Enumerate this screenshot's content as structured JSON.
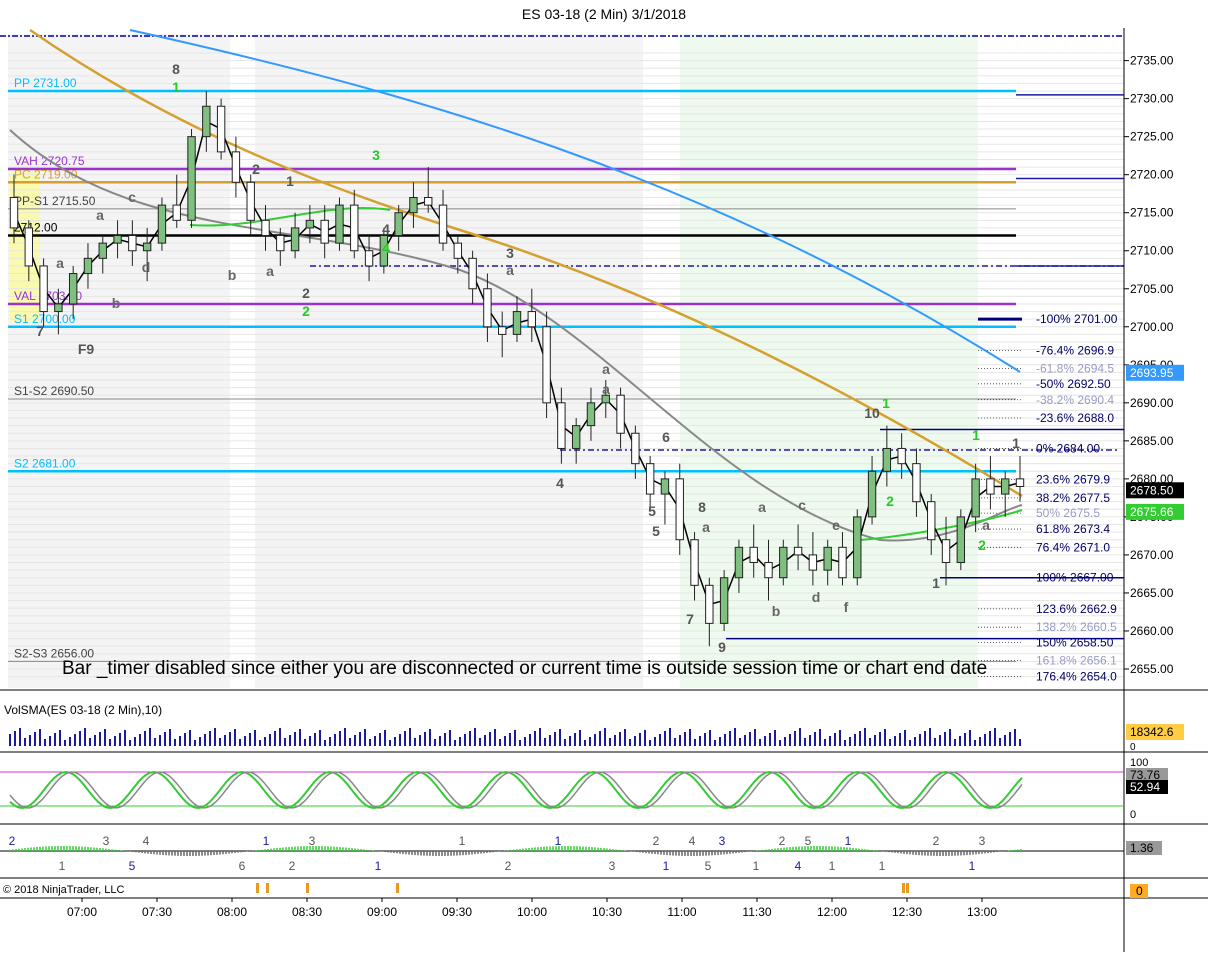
{
  "window": {
    "title": "ES 03-18 (2 Min)  3/1/2018"
  },
  "footer": {
    "copyright": "© 2018 NinjaTrader, LLC"
  },
  "colors": {
    "up": "#7fbf7f",
    "down": "#1a1a1a",
    "pivot": "#00bfff",
    "vah": "#9933cc",
    "pc": "#e6a23c",
    "sma_gray": "#888888",
    "sma_blue": "#3399ff",
    "sma_gold": "#d4a030",
    "fib": "#000080",
    "green": "#33cc33",
    "dash": "#0000aa"
  },
  "notice": {
    "text": "Bar _timer disabled since either you are disconnected or current time is outside session time or chart end date"
  },
  "chart_data": {
    "type": "candlestick",
    "title": "ES 03-18 (2 Min)  3/1/2018",
    "x_ticks": [
      "07:00",
      "07:30",
      "08:00",
      "08:30",
      "09:00",
      "09:30",
      "10:00",
      "10:30",
      "11:00",
      "11:30",
      "12:00",
      "12:30",
      "13:00"
    ],
    "y_ticks": [
      "2735.00",
      "2730.00",
      "2725.00",
      "2720.00",
      "2715.00",
      "2710.00",
      "2705.00",
      "2700.00",
      "2695.00",
      "2690.00",
      "2685.00",
      "2680.00",
      "2675.00",
      "2670.00",
      "2665.00",
      "2660.00",
      "2655.00"
    ],
    "ylim": [
      2652.5,
      2738.5
    ],
    "price_badges": [
      {
        "label": "2693.95",
        "value": 2693.95,
        "color": "#3399ff"
      },
      {
        "label": "2678.50",
        "value": 2678.5,
        "color": "#000000"
      },
      {
        "label": "2675.66",
        "value": 2675.66,
        "color": "#33cc33"
      }
    ],
    "levels": [
      {
        "label": "PP 2731.00",
        "value": 2731.0,
        "color": "#00bfff"
      },
      {
        "label": "VAH 2720.75",
        "value": 2720.75,
        "color": "#9933cc"
      },
      {
        "label": "PC 2719.00",
        "value": 2719.0,
        "color": "#d4a030"
      },
      {
        "label": "PP-S1 2715.50",
        "value": 2715.5,
        "color": "#888888"
      },
      {
        "label": "2712.00",
        "value": 2712.0,
        "color": "#000000"
      },
      {
        "label": "VAL 2703.00",
        "value": 2703.0,
        "color": "#9933cc"
      },
      {
        "label": "S1 2700.00",
        "value": 2700.0,
        "color": "#00bfff"
      },
      {
        "label": "S1-S2 2690.50",
        "value": 2690.5,
        "color": "#888888"
      },
      {
        "label": "S2 2681.00",
        "value": 2681.0,
        "color": "#00bfff"
      },
      {
        "label": "S2-S3 2656.00",
        "value": 2656.0,
        "color": "#888888"
      }
    ],
    "fib_levels": [
      {
        "label": "-100%  2701.00",
        "value": 2701.0
      },
      {
        "label": "-76.4%  2696.9",
        "value": 2696.9
      },
      {
        "label": "-61.8%  2694.5",
        "value": 2694.5
      },
      {
        "label": "-50%  2692.50",
        "value": 2692.5
      },
      {
        "label": "-38.2%  2690.4",
        "value": 2690.4
      },
      {
        "label": "-23.6%  2688.0",
        "value": 2688.0
      },
      {
        "label": "0%  2684.00",
        "value": 2684.0
      },
      {
        "label": "23.6%  2679.9",
        "value": 2679.9
      },
      {
        "label": "38.2%  2677.5",
        "value": 2677.5
      },
      {
        "label": "50%  2675.5",
        "value": 2675.5
      },
      {
        "label": "61.8%  2673.4",
        "value": 2673.4
      },
      {
        "label": "76.4%  2671.0",
        "value": 2671.0
      },
      {
        "label": "100%  2667.00",
        "value": 2667.0
      },
      {
        "label": "123.6%  2662.9",
        "value": 2662.9
      },
      {
        "label": "138.2%  2660.5",
        "value": 2660.5
      },
      {
        "label": "150%  2658.50",
        "value": 2658.5
      },
      {
        "label": "161.8%  2656.1",
        "value": 2656.1
      },
      {
        "label": "176.4%  2654.0",
        "value": 2654.0
      }
    ],
    "candles": [
      [
        2717,
        2720,
        2711,
        2713
      ],
      [
        2713,
        2714,
        2706,
        2708
      ],
      [
        2708,
        2709,
        2700,
        2702
      ],
      [
        2702,
        2705,
        2699,
        2703
      ],
      [
        2703,
        2708,
        2701,
        2707
      ],
      [
        2707,
        2711,
        2705,
        2709
      ],
      [
        2709,
        2712,
        2707,
        2711
      ],
      [
        2711,
        2714,
        2709,
        2712
      ],
      [
        2712,
        2714,
        2708,
        2710
      ],
      [
        2710,
        2713,
        2706,
        2711
      ],
      [
        2711,
        2717,
        2710,
        2716
      ],
      [
        2716,
        2720,
        2713,
        2714
      ],
      [
        2714,
        2726,
        2713,
        2725
      ],
      [
        2725,
        2731,
        2723,
        2729
      ],
      [
        2729,
        2730,
        2722,
        2723
      ],
      [
        2723,
        2725,
        2717,
        2719
      ],
      [
        2719,
        2720,
        2712,
        2714
      ],
      [
        2714,
        2716,
        2710,
        2712
      ],
      [
        2712,
        2713,
        2708,
        2710
      ],
      [
        2710,
        2715,
        2709,
        2713
      ],
      [
        2713,
        2716,
        2711,
        2714
      ],
      [
        2714,
        2716,
        2709,
        2711
      ],
      [
        2711,
        2717,
        2710,
        2716
      ],
      [
        2716,
        2718,
        2709,
        2710
      ],
      [
        2710,
        2712,
        2706,
        2708
      ],
      [
        2708,
        2713,
        2707,
        2712
      ],
      [
        2712,
        2716,
        2710,
        2715
      ],
      [
        2715,
        2719,
        2713,
        2717
      ],
      [
        2717,
        2721,
        2715,
        2716
      ],
      [
        2716,
        2718,
        2710,
        2711
      ],
      [
        2711,
        2712,
        2707,
        2709
      ],
      [
        2709,
        2710,
        2703,
        2705
      ],
      [
        2705,
        2707,
        2698,
        2700
      ],
      [
        2700,
        2702,
        2696,
        2699
      ],
      [
        2699,
        2704,
        2698,
        2702
      ],
      [
        2702,
        2705,
        2698,
        2700
      ],
      [
        2700,
        2702,
        2688,
        2690
      ],
      [
        2690,
        2692,
        2682,
        2684
      ],
      [
        2684,
        2688,
        2682,
        2687
      ],
      [
        2687,
        2692,
        2685,
        2690
      ],
      [
        2690,
        2693,
        2688,
        2691
      ],
      [
        2691,
        2692,
        2684,
        2686
      ],
      [
        2686,
        2687,
        2680,
        2682
      ],
      [
        2682,
        2683,
        2676,
        2678
      ],
      [
        2678,
        2681,
        2674,
        2680
      ],
      [
        2680,
        2682,
        2670,
        2672
      ],
      [
        2672,
        2673,
        2664,
        2666
      ],
      [
        2666,
        2667,
        2658,
        2661
      ],
      [
        2661,
        2668,
        2660,
        2667
      ],
      [
        2667,
        2672,
        2665,
        2671
      ],
      [
        2671,
        2674,
        2667,
        2669
      ],
      [
        2669,
        2672,
        2664,
        2667
      ],
      [
        2667,
        2672,
        2666,
        2671
      ],
      [
        2671,
        2674,
        2668,
        2670
      ],
      [
        2670,
        2673,
        2666,
        2668
      ],
      [
        2668,
        2672,
        2666,
        2671
      ],
      [
        2671,
        2673,
        2666,
        2667
      ],
      [
        2667,
        2676,
        2666,
        2675
      ],
      [
        2675,
        2683,
        2674,
        2681
      ],
      [
        2681,
        2687,
        2679,
        2684
      ],
      [
        2684,
        2686,
        2680,
        2682
      ],
      [
        2682,
        2684,
        2675,
        2677
      ],
      [
        2677,
        2678,
        2670,
        2672
      ],
      [
        2672,
        2675,
        2666,
        2669
      ],
      [
        2669,
        2676,
        2668,
        2675
      ],
      [
        2675,
        2682,
        2673,
        2680
      ],
      [
        2680,
        2683,
        2676,
        2678
      ],
      [
        2678,
        2681,
        2675,
        2680
      ],
      [
        2680,
        2683,
        2677,
        2679
      ]
    ],
    "annotations_text": [
      "8",
      "1",
      "2",
      "3",
      "1",
      "4",
      "a",
      "a",
      "2",
      "2",
      "a",
      "3",
      "4",
      "a",
      "6",
      "5",
      "7",
      "8",
      "a",
      "9",
      "a",
      "b",
      "c",
      "d",
      "e",
      "f",
      "10",
      "1",
      "2",
      "1",
      "1",
      "a",
      "2",
      "b",
      "F9",
      "7",
      "a",
      "b",
      "c",
      "d",
      "a",
      "1",
      "4",
      "5"
    ],
    "panels": {
      "volume": {
        "label": "VolSMA(ES 03-18 (2 Min),10)",
        "badges": [
          "18342.6",
          "0"
        ]
      },
      "stochastic": {
        "badges": [
          "73.76",
          "52.94"
        ],
        "ticks": [
          "100",
          "0"
        ]
      },
      "momentum": {
        "badges": [
          "1.36"
        ],
        "labels": [
          "2",
          "1",
          "3",
          "5",
          "4",
          "6",
          "1",
          "2",
          "3",
          "1",
          "1",
          "2",
          "1",
          "3",
          "2",
          "1",
          "4",
          "5",
          "3",
          "1",
          "2",
          "4",
          "5",
          "1",
          "1",
          "1",
          "2",
          "1",
          "3"
        ]
      },
      "events": {
        "badges": [
          "0"
        ]
      }
    }
  }
}
